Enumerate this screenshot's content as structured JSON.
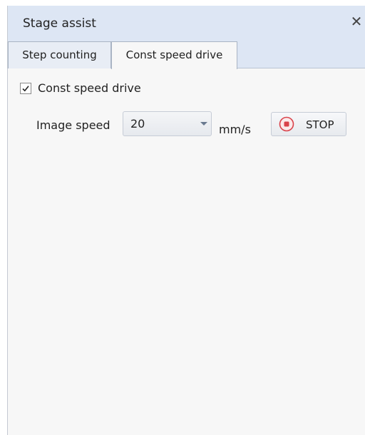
{
  "window": {
    "title": "Stage assist",
    "close_symbol": "✕"
  },
  "tabs": [
    {
      "label": "Step counting",
      "active": false
    },
    {
      "label": "Const speed drive",
      "active": true
    }
  ],
  "const_speed": {
    "checkbox_label": "Const speed drive",
    "checked": true,
    "speed_label": "Image speed",
    "speed_value": "20",
    "unit": "mm/s",
    "stop_label": "STOP"
  },
  "icons": {
    "close": "close-icon",
    "checkmark": "checkmark-icon",
    "dropdown": "chevron-down-icon",
    "stop": "stop-record-icon"
  },
  "colors": {
    "titlebar_bg": "#dde6f4",
    "content_bg": "#f7f7f7",
    "stop_red": "#d9424a"
  }
}
